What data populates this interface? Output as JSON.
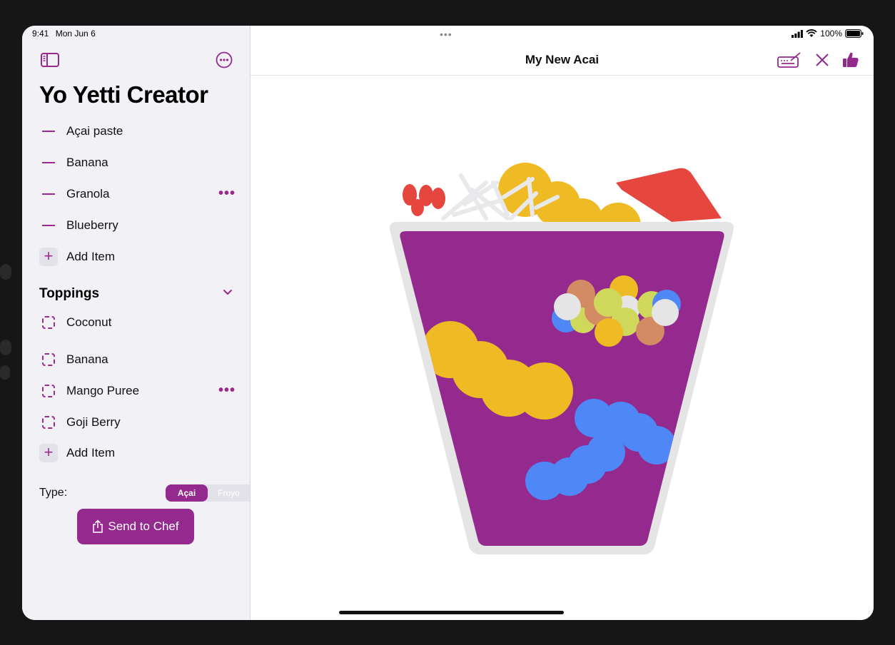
{
  "status": {
    "time": "9:41",
    "date": "Mon Jun 6",
    "battery": "100%"
  },
  "sidebar": {
    "title": "Yo Yetti Creator",
    "items": [
      {
        "label": "Açai paste"
      },
      {
        "label": "Banana"
      },
      {
        "label": "Granola"
      },
      {
        "label": "Blueberry"
      }
    ],
    "add_item_label": "Add Item",
    "toppings_title": "Toppings",
    "toppings": [
      {
        "label": "Coconut"
      },
      {
        "label": "Banana"
      },
      {
        "label": "Mango Puree"
      },
      {
        "label": "Goji Berry"
      }
    ],
    "toppings_add_label": "Add Item",
    "type_label": "Type:",
    "type_options": [
      "Açai",
      "Froyo"
    ],
    "type_selected": "Açai",
    "send_button": "Send to Chef"
  },
  "main": {
    "title": "My New Acai"
  },
  "colors": {
    "accent": "#94298e",
    "yellow": "#efbb24",
    "blue": "#4f87f6",
    "red": "#e5473f",
    "cup_rim": "#e5e5e6"
  },
  "icons": [
    "sidebar-toggle-icon",
    "ellipsis-circle-icon",
    "keyboard-pencil-icon",
    "close-icon",
    "thumbs-up-icon",
    "share-icon",
    "chevron-down-icon"
  ]
}
